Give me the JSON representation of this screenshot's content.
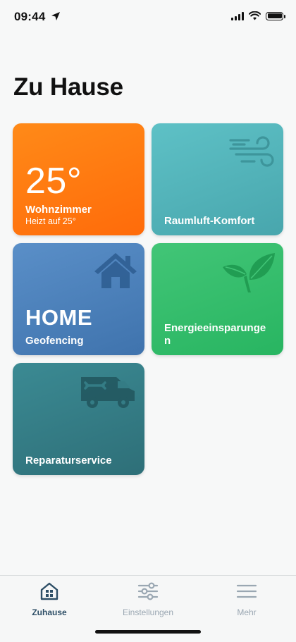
{
  "status_bar": {
    "time": "09:44",
    "icons": [
      "location-arrow-icon",
      "signal-icon",
      "wifi-icon",
      "battery-icon"
    ]
  },
  "page": {
    "title": "Zu Hause"
  },
  "tiles": [
    {
      "name": "heating",
      "value": "25°",
      "label": "Wohnzimmer",
      "sublabel": "Heizt auf 25°",
      "color": "#ff7a10"
    },
    {
      "name": "air-comfort",
      "label": "Raumluft-Komfort",
      "icon": "wind-icon",
      "color": "#55b5bb"
    },
    {
      "name": "geofencing",
      "value": "HOME",
      "label": "Geofencing",
      "icon": "house-icon",
      "color": "#4a80bb"
    },
    {
      "name": "energy-savings",
      "label": "Energieeinsparungen",
      "icon": "leaves-icon",
      "color": "#34bd6c"
    },
    {
      "name": "repair-service",
      "label": "Reparaturservice",
      "icon": "van-wrench-icon",
      "color": "#347c85"
    }
  ],
  "tab_bar": {
    "active": "Zuhause",
    "active_color": "#2d4e66",
    "inactive_color": "#9aa7b2",
    "items": [
      {
        "label": "Zuhause",
        "icon": "home-grid-icon"
      },
      {
        "label": "Einstellungen",
        "icon": "sliders-icon"
      },
      {
        "label": "Mehr",
        "icon": "menu-icon"
      }
    ]
  }
}
